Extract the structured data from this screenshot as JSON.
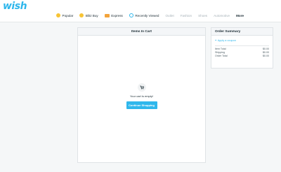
{
  "app": {
    "logo": "wish"
  },
  "nav": {
    "items": [
      {
        "label": "Popular",
        "icon": "star-icon",
        "style": "active"
      },
      {
        "label": "Blitz Buy",
        "icon": "blitz-buy-icon",
        "style": "active"
      },
      {
        "label": "Express",
        "icon": "express-truck-icon",
        "style": "active"
      },
      {
        "label": "Recently Viewed",
        "icon": "clock-icon",
        "style": "active"
      },
      {
        "label": "Outlet",
        "style": "muted"
      },
      {
        "label": "Fashion",
        "style": "muted"
      },
      {
        "label": "Shoes",
        "style": "muted"
      },
      {
        "label": "Automotive",
        "style": "muted"
      },
      {
        "label": "More",
        "style": "bold"
      }
    ]
  },
  "cart": {
    "title": "Items In Cart",
    "empty_message": "Your cart is empty!",
    "continue_label": "Continue Shopping"
  },
  "summary": {
    "title": "Order Summary",
    "coupon_plus": "+",
    "coupon_label": "Apply a coupon",
    "rows": [
      {
        "label": "Item Total",
        "value": "$0.00"
      },
      {
        "label": "Shipping",
        "value": "$0.00"
      },
      {
        "label": "Order Total",
        "value": "$0.00"
      }
    ]
  },
  "colors": {
    "brand": "#2fb7ec",
    "text": "#192a32",
    "muted": "#a7b2b8",
    "background": "#f5f7f8"
  }
}
